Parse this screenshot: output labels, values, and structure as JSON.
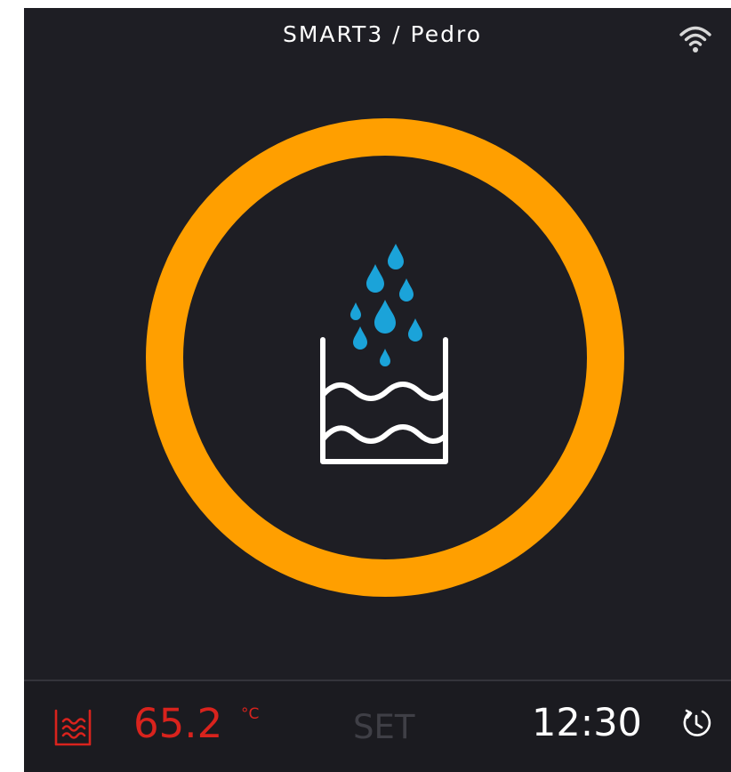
{
  "header": {
    "title": "SMART3 / Pedro",
    "wifi_icon": "wifi-icon"
  },
  "main": {
    "status_icon": "water-filling-icon",
    "ring_color": "#ff9f00",
    "drop_color": "#1ba3d9"
  },
  "footer": {
    "bath_icon": "water-bath-icon",
    "temperature": "65.2",
    "temperature_unit": "°C",
    "temperature_color": "#d9231d",
    "set_label": "SET",
    "time": "12:30",
    "timer_icon": "timer-icon"
  }
}
